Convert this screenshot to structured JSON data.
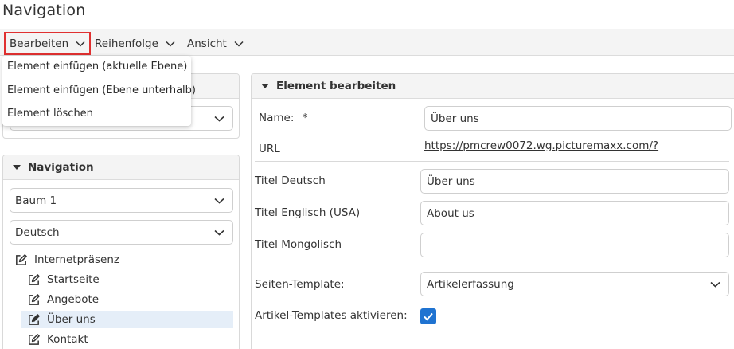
{
  "page": {
    "title": "Navigation"
  },
  "menubar": {
    "items": [
      {
        "label": "Bearbeiten"
      },
      {
        "label": "Reihenfolge"
      },
      {
        "label": "Ansicht"
      }
    ]
  },
  "dropdown": {
    "items": [
      {
        "label": "Element einfügen (aktuelle Ebene)"
      },
      {
        "label": "Element einfügen (Ebene unterhalb)"
      },
      {
        "label": "Element löschen"
      }
    ]
  },
  "nav_panel": {
    "title": "Navigation",
    "tree_select": "Baum 1",
    "language_select": "Deutsch",
    "tree": [
      {
        "label": "Internetpräsenz"
      },
      {
        "label": "Startseite"
      },
      {
        "label": "Angebote"
      },
      {
        "label": "Über uns"
      },
      {
        "label": "Kontakt"
      }
    ]
  },
  "edit_panel": {
    "title": "Element bearbeiten",
    "name_label": "Name:",
    "required_marker": "*",
    "name_value": "Über uns",
    "url_label": "URL",
    "url_value": "https://pmcrew0072.wg.picturemaxx.com/?",
    "title_de_label": "Titel Deutsch",
    "title_de_value": "Über uns",
    "title_en_label": "Titel Englisch (USA)",
    "title_en_value": "About us",
    "title_mn_label": "Titel Mongolisch",
    "title_mn_value": "",
    "template_label": "Seiten-Template:",
    "template_value": "Artikelerfassung",
    "article_templates_label": "Artikel-Templates aktivieren:",
    "article_templates_checked": true
  },
  "colors": {
    "accent": "#1f73d1",
    "highlight_border": "#e03030",
    "selected_row": "#e5eef8"
  }
}
